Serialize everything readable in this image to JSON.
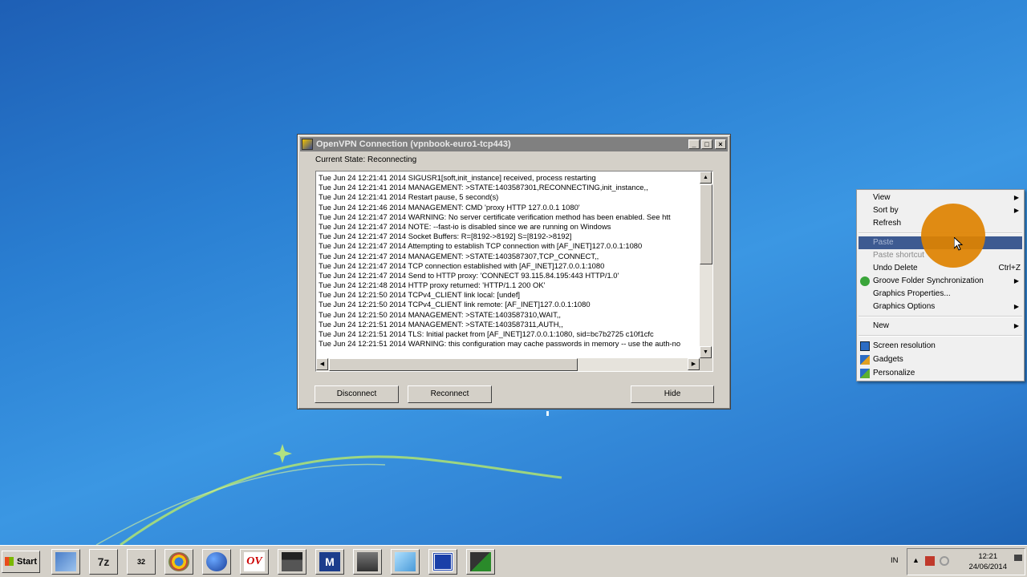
{
  "window": {
    "title": "OpenVPN Connection (vpnbook-euro1-tcp443)",
    "minimize": "_",
    "maximize": "□",
    "close": "×",
    "state_label": "Current State: Reconnecting",
    "log": [
      "Tue Jun 24 12:21:41 2014 SIGUSR1[soft,init_instance] received, process restarting",
      "Tue Jun 24 12:21:41 2014 MANAGEMENT: >STATE:1403587301,RECONNECTING,init_instance,,",
      "Tue Jun 24 12:21:41 2014 Restart pause, 5 second(s)",
      "Tue Jun 24 12:21:46 2014 MANAGEMENT: CMD 'proxy HTTP 127.0.0.1 1080'",
      "Tue Jun 24 12:21:47 2014 WARNING: No server certificate verification method has been enabled.  See htt",
      "Tue Jun 24 12:21:47 2014 NOTE: --fast-io is disabled since we are running on Windows",
      "Tue Jun 24 12:21:47 2014 Socket Buffers: R=[8192->8192] S=[8192->8192]",
      "Tue Jun 24 12:21:47 2014 Attempting to establish TCP connection with [AF_INET]127.0.0.1:1080",
      "Tue Jun 24 12:21:47 2014 MANAGEMENT: >STATE:1403587307,TCP_CONNECT,,",
      "Tue Jun 24 12:21:47 2014 TCP connection established with [AF_INET]127.0.0.1:1080",
      "Tue Jun 24 12:21:47 2014 Send to HTTP proxy: 'CONNECT 93.115.84.195:443 HTTP/1.0'",
      "Tue Jun 24 12:21:48 2014 HTTP proxy returned: 'HTTP/1.1 200 OK'",
      "Tue Jun 24 12:21:50 2014 TCPv4_CLIENT link local: [undef]",
      "Tue Jun 24 12:21:50 2014 TCPv4_CLIENT link remote: [AF_INET]127.0.0.1:1080",
      "Tue Jun 24 12:21:50 2014 MANAGEMENT: >STATE:1403587310,WAIT,,",
      "Tue Jun 24 12:21:51 2014 MANAGEMENT: >STATE:1403587311,AUTH,,",
      "Tue Jun 24 12:21:51 2014 TLS: Initial packet from [AF_INET]127.0.0.1:1080, sid=bc7b2725 c10f1cfc",
      "Tue Jun 24 12:21:51 2014 WARNING: this configuration may cache passwords in memory -- use the auth-no"
    ],
    "buttons": {
      "disconnect": "Disconnect",
      "reconnect": "Reconnect",
      "hide": "Hide"
    }
  },
  "context_menu": {
    "view": "View",
    "sort_by": "Sort by",
    "refresh": "Refresh",
    "paste": "Paste",
    "paste_shortcut": "Paste shortcut",
    "undo_delete": "Undo Delete",
    "undo_delete_key": "Ctrl+Z",
    "groove": "Groove Folder Synchronization",
    "graphics_properties": "Graphics Properties...",
    "graphics_options": "Graphics Options",
    "new": "New",
    "screen_resolution": "Screen resolution",
    "gadgets": "Gadgets",
    "personalize": "Personalize"
  },
  "taskbar": {
    "start": "Start",
    "language": "IN",
    "time": "12:21",
    "date": "24/06/2014",
    "items": [
      {
        "icon": "network-icon",
        "text": ""
      },
      {
        "icon": "7zip-icon",
        "text": "7z"
      },
      {
        "icon": "chip-32-icon",
        "text": "32"
      },
      {
        "icon": "chrome-icon",
        "text": ""
      },
      {
        "icon": "globe-icon",
        "text": ""
      },
      {
        "icon": "ov-app-icon",
        "text": "OV"
      },
      {
        "icon": "clapperboard-icon",
        "text": ""
      },
      {
        "icon": "m-app-icon",
        "text": "M"
      },
      {
        "icon": "scanner-icon",
        "text": ""
      },
      {
        "icon": "notepad-icon",
        "text": ""
      },
      {
        "icon": "window-app-icon",
        "text": ""
      },
      {
        "icon": "network-monitor-icon",
        "text": ""
      }
    ]
  },
  "colors": {
    "highlight": "#3d5a91",
    "cursor_halo": "#de8200",
    "desktop_blue": "#2a7fd2"
  }
}
